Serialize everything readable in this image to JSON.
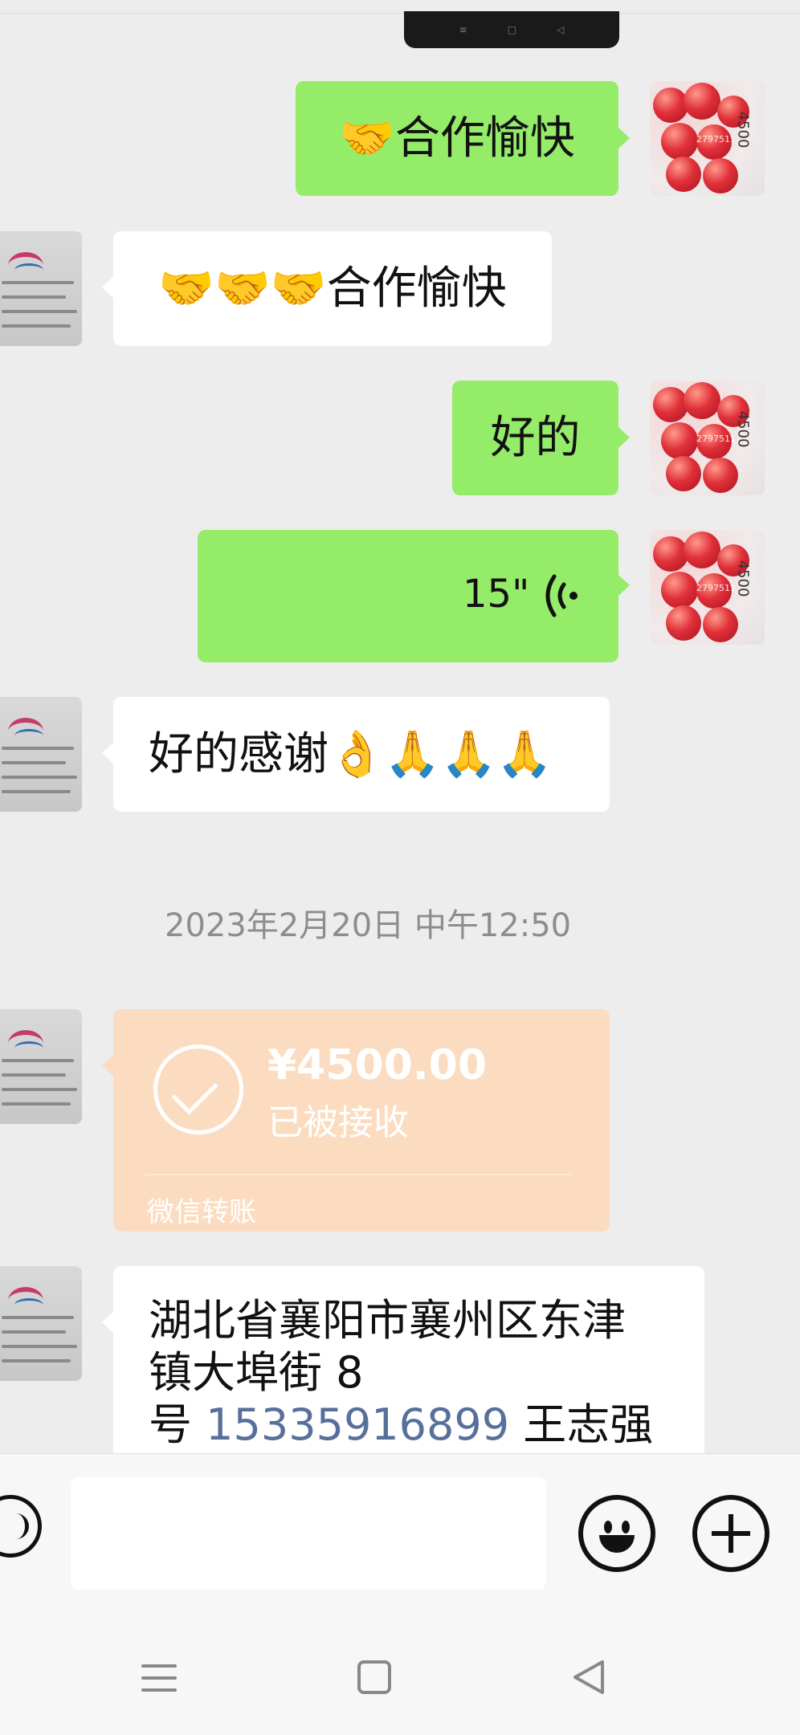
{
  "nav_pill": {
    "menu_glyph": "≡",
    "home_glyph": "□",
    "back_glyph": "◁"
  },
  "messages": [
    {
      "side": "right",
      "type": "text",
      "text": "🤝合作愉快"
    },
    {
      "side": "left",
      "type": "text",
      "text": "🤝🤝🤝合作愉快"
    },
    {
      "side": "right",
      "type": "text",
      "text": "好的"
    },
    {
      "side": "right",
      "type": "voice",
      "duration": "15\""
    },
    {
      "side": "left",
      "type": "text",
      "text": "好的感谢👌🙏🙏🙏"
    }
  ],
  "timestamp": "2023年2月20日 中午12:50",
  "transfer": {
    "amount": "¥4500.00",
    "status": "已被接收",
    "label": "微信转账"
  },
  "address_message": {
    "line1": "湖北省襄阳市襄州区东津",
    "line2": "镇大埠街 8",
    "line3_prefix": "号 ",
    "phone": "15335916899",
    "line3_suffix": " 王志强"
  },
  "avatar_watermark": "2797511",
  "avatar_side_text": "4500",
  "colors": {
    "chat_bg": "#ededed",
    "self_bubble": "#95ec69",
    "other_bubble": "#ffffff",
    "transfer_card": "#fcdcc0",
    "link": "#57709b"
  },
  "icons": {
    "voice_wave": "voice-wave-icon",
    "transfer_check": "check-circle-icon",
    "voice_toggle": "voice-mode-icon",
    "emoji": "smiley-icon",
    "plus": "plus-circle-icon"
  }
}
